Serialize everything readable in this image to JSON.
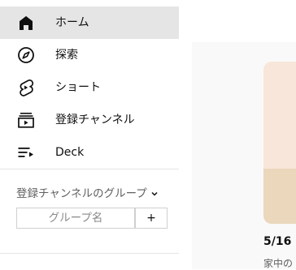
{
  "sidebar": {
    "items": [
      {
        "label": "ホーム",
        "icon": "home-icon",
        "active": true
      },
      {
        "label": "探索",
        "icon": "compass-icon",
        "active": false
      },
      {
        "label": "ショート",
        "icon": "shorts-icon",
        "active": false
      },
      {
        "label": "登録チャンネル",
        "icon": "subscriptions-icon",
        "active": false
      },
      {
        "label": "Deck",
        "icon": "playlist-icon",
        "active": false
      }
    ],
    "group_title": "登録チャンネルのグループ",
    "group_input_placeholder": "グループ名",
    "add_button_label": "+"
  },
  "content": {
    "card_title": "5/16",
    "card_subtitle": "家中の"
  },
  "colors": {
    "active_bg": "#e5e5e5",
    "divider": "#e5e5e5",
    "thumb_top": "#f9e6da",
    "thumb_floor": "#ead7bc"
  }
}
